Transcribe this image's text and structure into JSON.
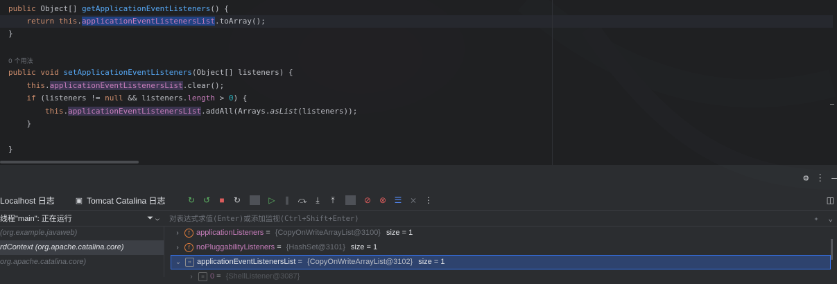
{
  "editor": {
    "hint": "0 个用法",
    "lines": [
      "public Object[] getApplicationEventListeners() {",
      "    return this.applicationEventListenersList.toArray();",
      "}",
      "public void setApplicationEventListeners(Object[] listeners) {",
      "    this.applicationEventListenersList.clear();",
      "    if (listeners != null && listeners.length > 0) {",
      "        this.applicationEventListenersList.addAll(Arrays.asList(listeners));",
      "    }",
      "}"
    ]
  },
  "debug": {
    "toolbar_icons": [
      "settings-icon",
      "more-vertical-icon",
      "minimize-icon"
    ],
    "tabs": [
      {
        "label": "Localhost 日志",
        "icon": "log-icon"
      },
      {
        "label": "Tomcat Catalina 日志",
        "icon": "console-icon"
      }
    ],
    "right_icon": "layout-icon",
    "thread_selector": "线程\"main\": 正在运行",
    "eval_placeholder": "对表达式求值(Enter)或添加监视(Ctrl+Shift+Enter)",
    "frames": [
      {
        "text": "(org.example.javaweb)"
      },
      {
        "text": "rdContext (org.apache.catalina.core)"
      },
      {
        "text": "org.apache.catalina.core)"
      }
    ],
    "variables": [
      {
        "name": "applicationListeners",
        "type": "{CopyOnWriteArrayList@3100}",
        "size": "size = 1",
        "icon": "field-icon",
        "expanded": false
      },
      {
        "name": "noPluggabilityListeners",
        "type": "{HashSet@3101}",
        "size": "size = 1",
        "icon": "field-icon",
        "expanded": false
      },
      {
        "name": "applicationEventListenersList",
        "type": "{CopyOnWriteArrayList@3102}",
        "size": "size = 1",
        "icon": "watch-icon",
        "expanded": true
      },
      {
        "name": "0",
        "type": "{ShellListener@3087}",
        "size": "",
        "icon": "element-icon",
        "expanded": false
      }
    ]
  }
}
